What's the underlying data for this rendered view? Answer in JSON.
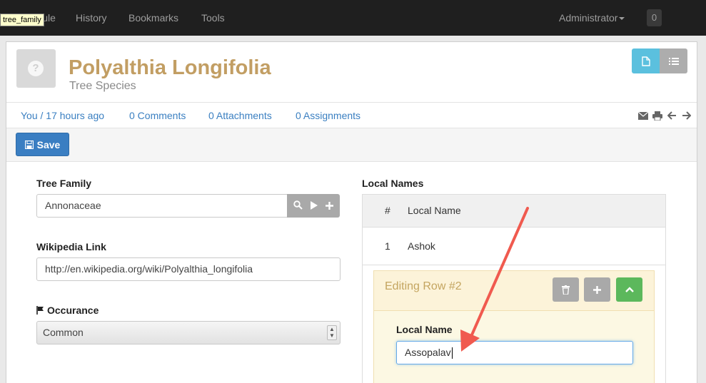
{
  "navbar": {
    "tooltip": "tree_family",
    "items": [
      "Module",
      "History",
      "Bookmarks",
      "Tools"
    ],
    "user_menu": "Administrator",
    "badge": "0"
  },
  "record": {
    "title": "Polyalthia Longifolia",
    "subtitle": "Tree Species",
    "meta": {
      "owner_time": "You / 17 hours ago",
      "comments": "0 Comments",
      "attachments": "0 Attachments",
      "assignments": "0 Assignments"
    },
    "meta_icons": [
      "envelope-icon",
      "print-icon",
      "arrow-left-icon",
      "arrow-right-icon"
    ]
  },
  "toolbar": {
    "save_label": "Save"
  },
  "form": {
    "tree_family": {
      "label": "Tree Family",
      "value": "Annonaceae"
    },
    "wikipedia": {
      "label": "Wikipedia Link",
      "value": "http://en.wikipedia.org/wiki/Polyalthia_longifolia"
    },
    "occurance": {
      "label": "Occurance",
      "selected": "Common"
    }
  },
  "local_names": {
    "label": "Local Names",
    "columns": [
      "#",
      "Local Name"
    ],
    "rows": [
      {
        "num": "1",
        "name": "Ashok"
      }
    ],
    "editing": {
      "title": "Editing Row #2",
      "field_label": "Local Name",
      "value": "Assopalav"
    }
  },
  "colors": {
    "title": "#c29e63",
    "link": "#3a7fc1",
    "primary": "#3a7ec2",
    "info": "#5bc0de",
    "success": "#5cb85c",
    "annotation_arrow": "#f05a4f"
  }
}
